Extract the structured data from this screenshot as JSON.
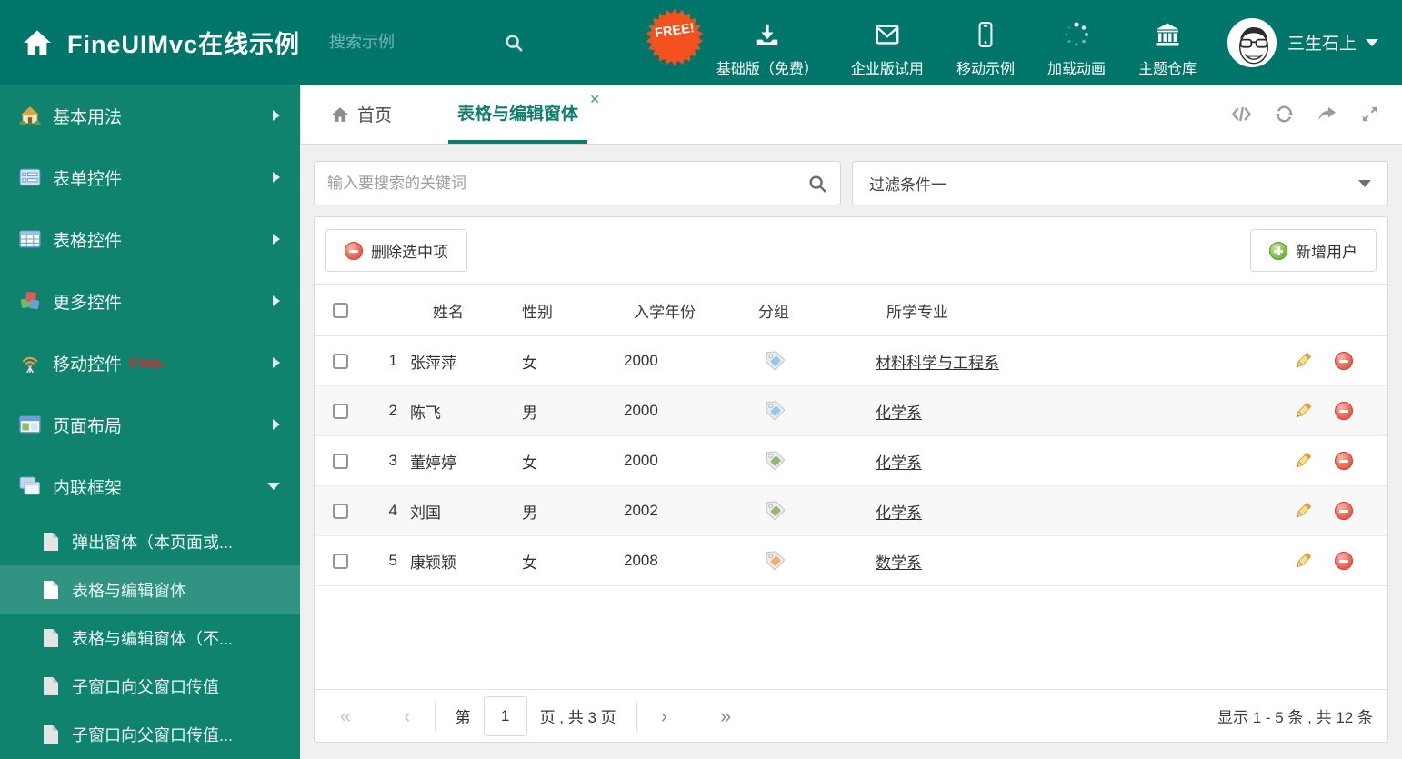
{
  "header": {
    "title": "FineUIMvc在线示例",
    "search_placeholder": "搜索示例",
    "free_badge": "FREE!",
    "nav": [
      {
        "label": "基础版（免费）"
      },
      {
        "label": "企业版试用"
      },
      {
        "label": "移动示例"
      },
      {
        "label": "加载动画"
      },
      {
        "label": "主题仓库"
      }
    ],
    "user_name": "三生石上"
  },
  "sidebar": {
    "items": [
      {
        "label": "基本用法"
      },
      {
        "label": "表单控件"
      },
      {
        "label": "表格控件"
      },
      {
        "label": "更多控件"
      },
      {
        "label": "移动控件",
        "badge": "Corp."
      },
      {
        "label": "页面布局"
      },
      {
        "label": "内联框架"
      }
    ],
    "subitems": [
      {
        "label": "弹出窗体（本页面或..."
      },
      {
        "label": "表格与编辑窗体"
      },
      {
        "label": "表格与编辑窗体（不..."
      },
      {
        "label": "子窗口向父窗口传值"
      },
      {
        "label": "子窗口向父窗口传值..."
      }
    ]
  },
  "tabs": {
    "home": "首页",
    "active": "表格与编辑窗体",
    "close_glyph": "✕"
  },
  "filters": {
    "search_placeholder": "输入要搜索的关键词",
    "filter_value": "过滤条件一"
  },
  "toolbar": {
    "delete_label": "删除选中项",
    "add_label": "新增用户"
  },
  "table": {
    "columns": {
      "name": "姓名",
      "gender": "性别",
      "year": "入学年份",
      "group": "分组",
      "major": "所学专业"
    },
    "rows": [
      {
        "num": "1",
        "name": "张萍萍",
        "gender": "女",
        "year": "2000",
        "tag_color": "#8dc9f2",
        "major": "材料科学与工程系"
      },
      {
        "num": "2",
        "name": "陈飞",
        "gender": "男",
        "year": "2000",
        "tag_color": "#8dc9f2",
        "major": "化学系"
      },
      {
        "num": "3",
        "name": "董婷婷",
        "gender": "女",
        "year": "2000",
        "tag_color": "#93b874",
        "major": "化学系"
      },
      {
        "num": "4",
        "name": "刘国",
        "gender": "男",
        "year": "2002",
        "tag_color": "#93b874",
        "major": "化学系"
      },
      {
        "num": "5",
        "name": "康颖颖",
        "gender": "女",
        "year": "2008",
        "tag_color": "#f6ae6b",
        "major": "数学系"
      }
    ]
  },
  "pagination": {
    "first": "«",
    "prev": "‹",
    "next": "›",
    "last": "»",
    "prefix": "第",
    "page": "1",
    "suffix": "页 , 共 3 页",
    "summary": "显示 1 - 5 条 , 共 12 条"
  },
  "colors": {
    "header_bg": "#00756a",
    "sidebar_bg": "#10836e",
    "accent": "#117c6e",
    "badge": "#f4511e"
  }
}
